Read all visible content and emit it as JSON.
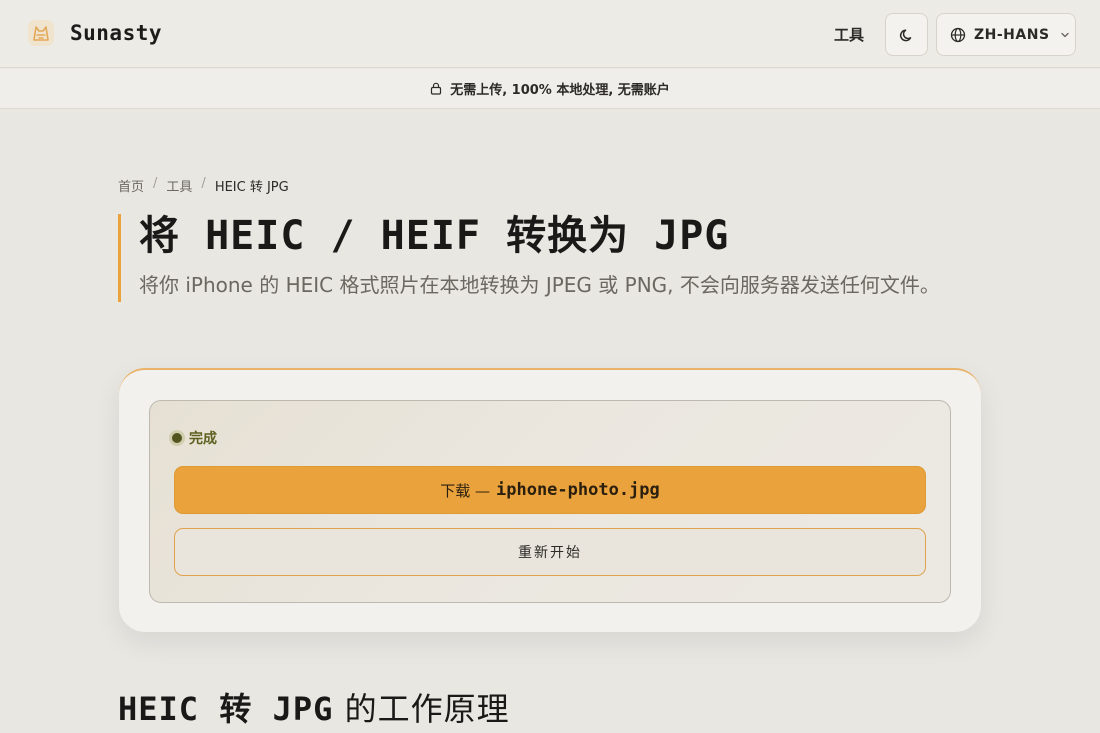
{
  "header": {
    "brand": "Sunasty",
    "nav_tools": "工具",
    "language": "ZH-HANS",
    "icons": {
      "logo": "fox-logo-icon",
      "theme": "moon-icon",
      "language": "globe-icon",
      "chevron": "chevron-down-icon"
    }
  },
  "banner": {
    "text": "无需上传, 100% 本地处理, 无需账户",
    "icon": "lock-icon"
  },
  "breadcrumb": {
    "home": "首页",
    "tools": "工具",
    "current": "HEIC 转 JPG"
  },
  "hero": {
    "title": "将 HEIC / HEIF 转换为 JPG",
    "subtitle": "将你 iPhone 的 HEIC 格式照片在本地转换为 JPEG 或 PNG, 不会向服务器发送任何文件。"
  },
  "converter": {
    "status": "完成",
    "download_prefix": "下载 —",
    "download_file": "iphone-photo.jpg",
    "restart": "重新开始"
  },
  "section": {
    "title_mono": "HEIC 转 JPG",
    "title_rest": " 的工作原理"
  },
  "colors": {
    "accent": "#e9a23c",
    "background": "#e9e7e2",
    "status": "#52551f"
  }
}
